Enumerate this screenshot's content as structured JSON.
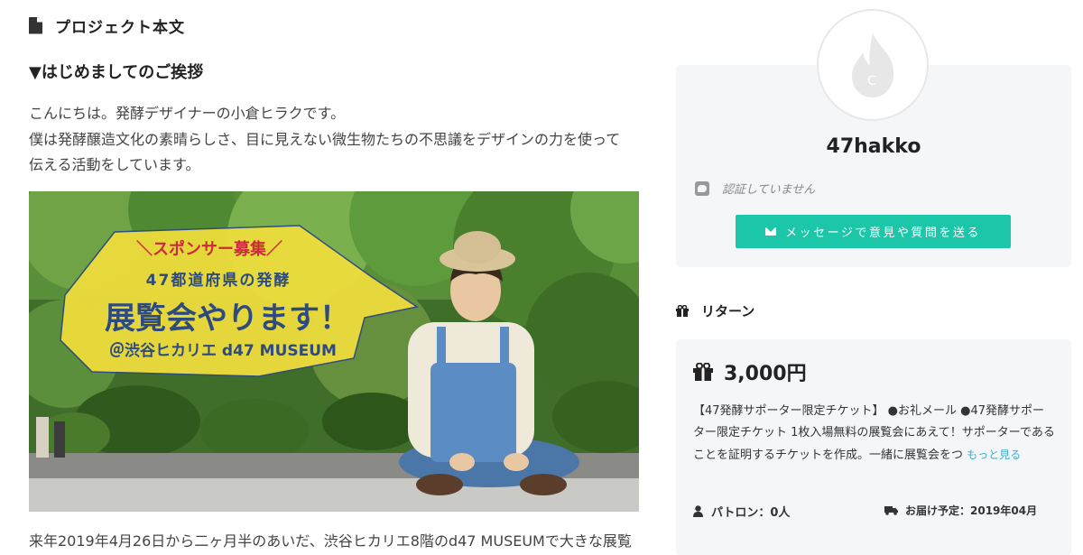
{
  "main": {
    "section_title": "プロジェクト本文",
    "greeting_title": "▼はじめましてのご挨拶",
    "intro_lines": [
      "こんにちは。発酵デザイナーの小倉ヒラクです。",
      "僕は発酵醸造文化の素晴らしさ、目に見えない微生物たちの不思議をデザインの力を使って",
      "伝える活動をしています。"
    ],
    "banner": {
      "sponsor": "＼スポンサー募集／",
      "line1": "47都道府県の発酵",
      "line2": "展覧会やります！",
      "line3": "＠渋谷ヒカリエ d47 MUSEUM"
    },
    "bottom_text": "来年2019年4月26日から二ヶ月半のあいだ、渋谷ヒカリエ8階のd47 MUSEUMで大きな展覧"
  },
  "profile": {
    "username": "47hakko",
    "verify_text": "認証していません",
    "message_button": "メッセージで意見や質問を送る"
  },
  "returns": {
    "title": "リターン",
    "price": "3,000円",
    "description": "【47発酵サポーター限定チケット】 ●お礼メール ●47発酵サポーター限定チケット 1枚入場無料の展覧会にあえて！サポーターであることを証明するチケットを作成。一緒に展覧会をつ",
    "more_link": "もっと見る",
    "patron_label": "パトロン：0人",
    "delivery_label": "お届け予定：2019年04月"
  },
  "colors": {
    "accent": "#1cc7a9",
    "link": "#3bb0cf",
    "card_bg": "#f5f6f8",
    "banner_yellow": "#ecdc3c"
  }
}
